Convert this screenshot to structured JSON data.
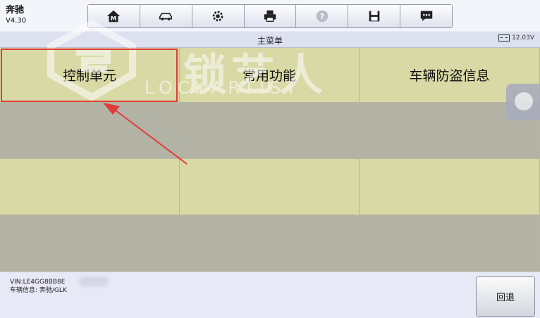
{
  "app": {
    "name": "奔驰",
    "version": "V4.30"
  },
  "toolbar": {
    "buttons": [
      {
        "icon": "home-icon"
      },
      {
        "icon": "car-icon"
      },
      {
        "icon": "gear-icon"
      },
      {
        "icon": "printer-icon"
      },
      {
        "icon": "help-icon"
      },
      {
        "icon": "save-icon"
      },
      {
        "icon": "message-icon"
      }
    ]
  },
  "header": {
    "title": "主菜单",
    "battery": "12.03V"
  },
  "menu": {
    "cells": [
      "控制单元",
      "常用功能",
      "车辆防盗信息",
      "",
      "",
      "",
      "",
      "",
      "",
      "",
      "",
      ""
    ]
  },
  "footer": {
    "vin_label": "VIN:LE4GG8BB8E",
    "vehicle_info": "车辆信息: 奔驰/GLK",
    "back_label": "回退"
  },
  "watermark": {
    "cn": "锁艺人",
    "en": "LOCKARTIST"
  },
  "colors": {
    "cell_light": "#d9d9a6",
    "cell_dark": "#b3b3a5",
    "highlight": "#e23b3b",
    "toolbar_bg": "#e7ebf5"
  }
}
